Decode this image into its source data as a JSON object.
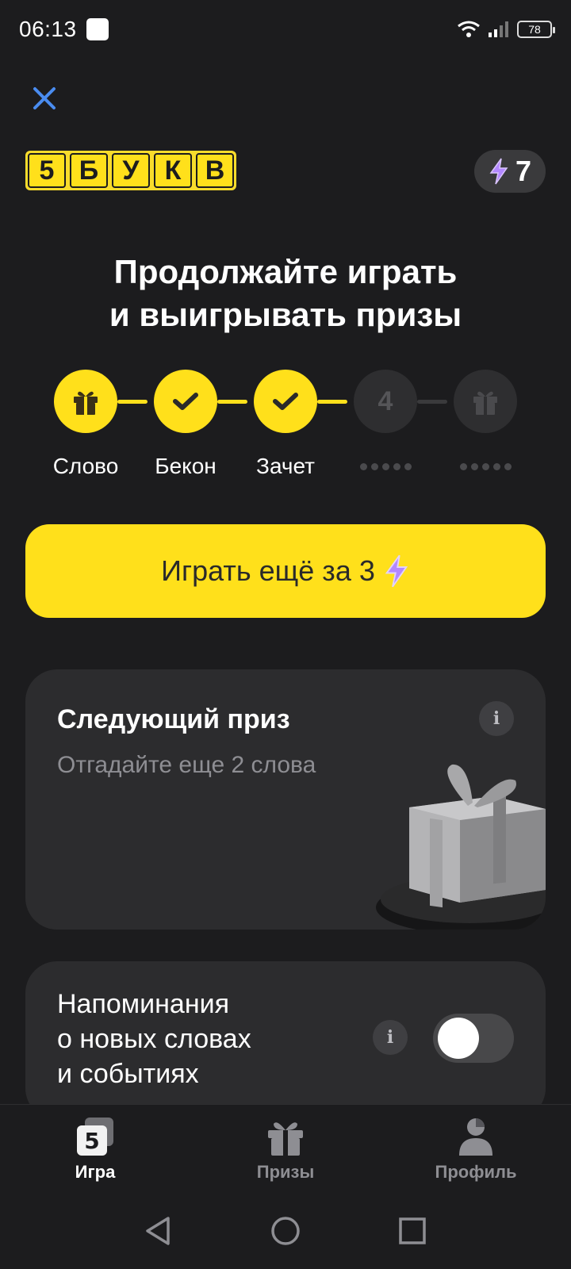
{
  "status_bar": {
    "time": "06:13",
    "battery": "78"
  },
  "logo": {
    "letters": [
      "5",
      "Б",
      "У",
      "К",
      "В"
    ]
  },
  "energy": {
    "count": "7"
  },
  "headline": {
    "line1": "Продолжайте играть",
    "line2": "и выигрывать призы"
  },
  "progress": {
    "steps": [
      {
        "label": "Слово",
        "state": "gift"
      },
      {
        "label": "Бекон",
        "state": "check"
      },
      {
        "label": "Зачет",
        "state": "check"
      },
      {
        "number": "4",
        "state": "locked"
      },
      {
        "state": "locked-gift"
      }
    ]
  },
  "play_button": {
    "label": "Играть ещё за 3"
  },
  "prize_card": {
    "title": "Следующий приз",
    "subtitle": "Отгадайте еще 2 слова"
  },
  "reminder_card": {
    "line1": "Напоминания",
    "line2": "о новых словах",
    "line3": "и событиях",
    "toggle_on": false
  },
  "tabs": [
    {
      "label": "Игра",
      "icon": "game-icon",
      "active": true
    },
    {
      "label": "Призы",
      "icon": "gift-icon",
      "active": false
    },
    {
      "label": "Профиль",
      "icon": "profile-icon",
      "active": false
    }
  ],
  "colors": {
    "accent": "#ffe01b",
    "background": "#1c1c1e",
    "card": "#2c2c2e",
    "energy": "#b388ff"
  }
}
